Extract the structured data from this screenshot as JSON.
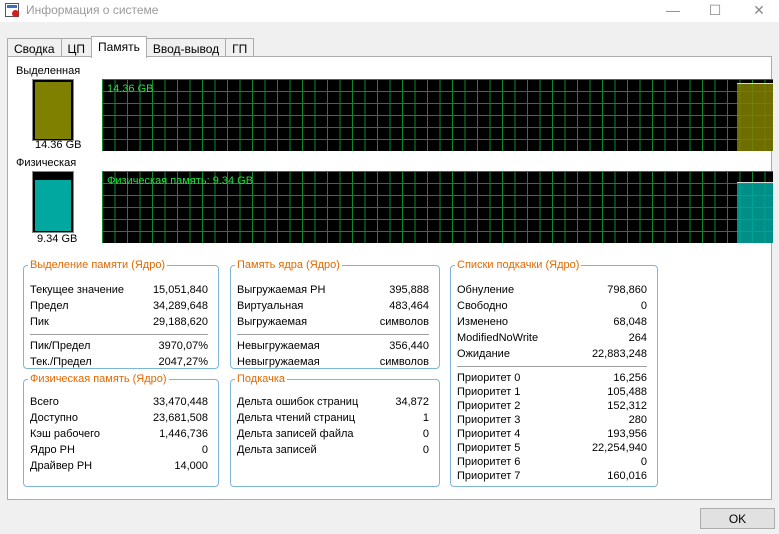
{
  "window": {
    "title": "Информация о системе",
    "minimize": "—",
    "maximize": "☐",
    "close": "✕"
  },
  "tabs": [
    {
      "label": "Сводка",
      "active": false
    },
    {
      "label": "ЦП",
      "active": false
    },
    {
      "label": "Память",
      "active": true
    },
    {
      "label": "Ввод-вывод",
      "active": false
    },
    {
      "label": "ГП",
      "active": false
    }
  ],
  "commit": {
    "label": "Выделенная",
    "value": "14.36 GB",
    "graph_text": "14.36 GB",
    "color": "#808000",
    "level": 0.95
  },
  "physical": {
    "label": "Физическая",
    "value": "9.34 GB",
    "graph_text": "Физическая память: 9.34 GB",
    "color": "#00a8a0",
    "level": 0.85
  },
  "accent": "#e06a00",
  "graph_text_color": "#20e040",
  "groups": {
    "commit": {
      "title": "Выделение памяти (Ядро)",
      "rows": [
        {
          "label": "Текущее значение",
          "value": "15,051,840"
        },
        {
          "label": "Предел",
          "value": "34,289,648"
        },
        {
          "label": "Пик",
          "value": "29,188,620"
        },
        {
          "label": "Пик/Предел",
          "value": "3970,07%"
        },
        {
          "label": "Тек./Предел",
          "value": "2047,27%"
        }
      ]
    },
    "kernel": {
      "title": "Память ядра (Ядро)",
      "rows": [
        {
          "label": "Выгружаемая PH",
          "value": "395,888"
        },
        {
          "label": "Виртуальная",
          "value": "483,464"
        },
        {
          "label": "Выгружаемая",
          "value": "символов"
        },
        {
          "label": "Невыгружаемая",
          "value": "356,440"
        },
        {
          "label": "Невыгружаемая",
          "value": "символов"
        }
      ]
    },
    "paging_lists": {
      "title": "Списки подкачки (Ядро)",
      "rows": [
        {
          "label": "Обнуление",
          "value": "798,860"
        },
        {
          "label": "Свободно",
          "value": "0"
        },
        {
          "label": "Изменено",
          "value": "68,048"
        },
        {
          "label": "ModifiedNoWrite",
          "value": "264"
        },
        {
          "label": "Ожидание",
          "value": "22,883,248"
        },
        {
          "label": "Приоритет 0",
          "value": "16,256"
        },
        {
          "label": "Приоритет 1",
          "value": "105,488"
        },
        {
          "label": "Приоритет 2",
          "value": "152,312"
        },
        {
          "label": "Приоритет 3",
          "value": "280"
        },
        {
          "label": "Приоритет 4",
          "value": "193,956"
        },
        {
          "label": "Приоритет 5",
          "value": "22,254,940"
        },
        {
          "label": "Приоритет 6",
          "value": "0"
        },
        {
          "label": "Приоритет 7",
          "value": "160,016"
        }
      ]
    },
    "physical": {
      "title": "Физическая память (Ядро)",
      "rows": [
        {
          "label": "Всего",
          "value": "33,470,448"
        },
        {
          "label": "Доступно",
          "value": "23,681,508"
        },
        {
          "label": "Кэш рабочего",
          "value": "1,446,736"
        },
        {
          "label": "Ядро PH",
          "value": "0"
        },
        {
          "label": "Драйвер PH",
          "value": "14,000"
        }
      ]
    },
    "paging": {
      "title": "Подкачка",
      "rows": [
        {
          "label": "Дельта ошибок страниц",
          "value": "34,872"
        },
        {
          "label": "Дельта чтений страниц",
          "value": "1"
        },
        {
          "label": "Дельта записей файла",
          "value": "0"
        },
        {
          "label": "Дельта записей",
          "value": "0"
        }
      ]
    }
  },
  "ok_label": "OK"
}
